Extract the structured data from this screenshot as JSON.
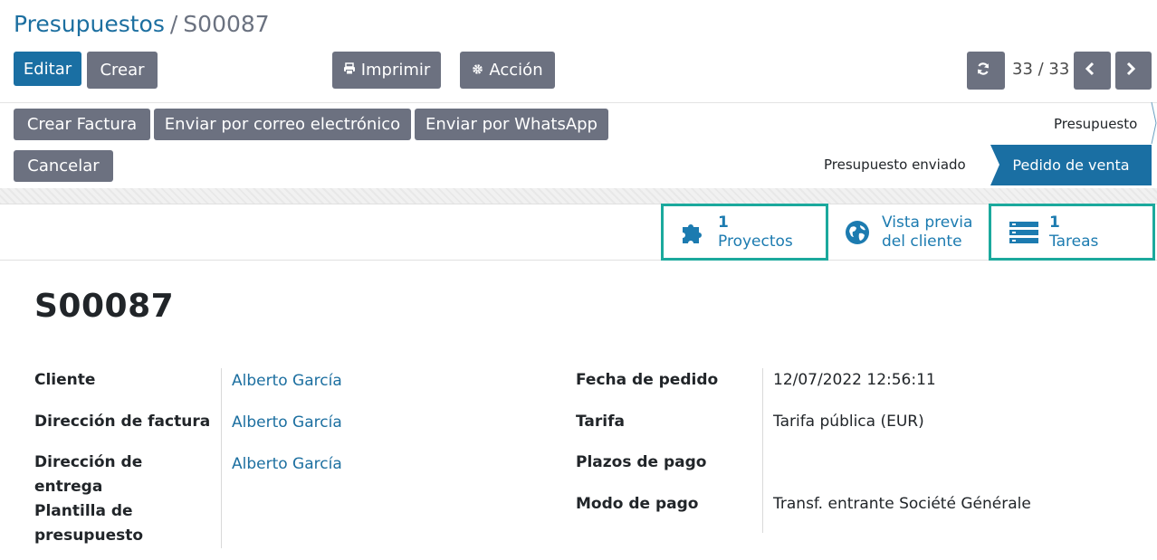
{
  "breadcrumb": {
    "parent": "Presupuestos",
    "separator": "/",
    "current": "S00087"
  },
  "toolbar": {
    "edit_label": "Editar",
    "create_label": "Crear",
    "print_label": "Imprimir",
    "action_label": "Acción",
    "pager_text": "33 / 33"
  },
  "actions": {
    "create_invoice": "Crear Factura",
    "send_email": "Enviar por correo electrónico",
    "send_whatsapp": "Enviar por WhatsApp",
    "cancel": "Cancelar"
  },
  "statusbar": {
    "stages": [
      {
        "label": "Presupuesto",
        "active": false
      },
      {
        "label": "Presupuesto enviado",
        "active": false
      },
      {
        "label": "Pedido de venta",
        "active": true
      }
    ]
  },
  "smart_buttons": [
    {
      "icon": "puzzle-icon",
      "count": "1",
      "label": "Proyectos",
      "highlighted": true
    },
    {
      "icon": "globe-icon",
      "line1": "Vista previa",
      "line2": "del cliente",
      "highlighted": false
    },
    {
      "icon": "tasks-icon",
      "count": "1",
      "label": "Tareas",
      "highlighted": true
    }
  ],
  "record": {
    "title": "S00087",
    "left_fields": [
      {
        "label": "Cliente",
        "value": "Alberto García"
      },
      {
        "label": "Dirección de factura",
        "value": "Alberto García"
      },
      {
        "label": "Dirección de entrega",
        "value": "Alberto García"
      },
      {
        "label": "Plantilla de presupuesto",
        "value": ""
      }
    ],
    "right_fields": [
      {
        "label": "Fecha de pedido",
        "value": "12/07/2022 12:56:11"
      },
      {
        "label": "Tarifa",
        "value": "Tarifa pública (EUR)"
      },
      {
        "label": "Plazos de pago",
        "value": ""
      },
      {
        "label": "Modo de pago",
        "value": "Transf. entrante Société Générale"
      }
    ]
  },
  "colors": {
    "primary": "#1a6fa3",
    "secondary": "#6c7180",
    "link": "#1c6fa0",
    "highlight": "#1ba99d"
  }
}
